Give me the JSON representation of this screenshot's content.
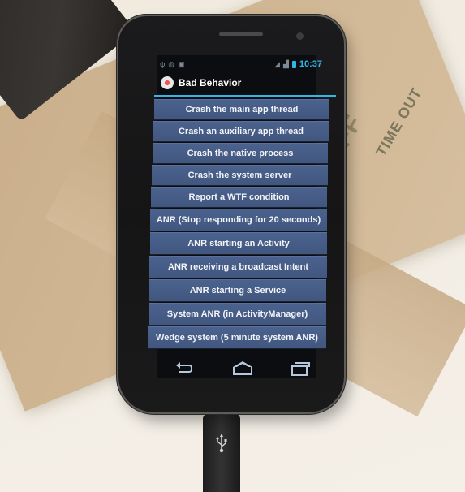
{
  "scene": {
    "napkin_print": {
      "line1": "OFF",
      "line2": "ON",
      "line3": "TIME OUT"
    }
  },
  "device": {
    "status_bar": {
      "left_icons": [
        "usb-debug-icon",
        "android-icon",
        "image-icon"
      ],
      "right_icons": [
        "signal-icon",
        "cellular-icon",
        "battery-icon"
      ],
      "time": "10:37"
    },
    "app": {
      "icon": "gear-icon",
      "title": "Bad Behavior",
      "accent_color": "#33b5e5",
      "buttons": [
        {
          "label": "Crash the main app thread"
        },
        {
          "label": "Crash an auxiliary app thread"
        },
        {
          "label": "Crash the native process"
        },
        {
          "label": "Crash the system server"
        },
        {
          "label": "Report a WTF condition"
        },
        {
          "label": "ANR (Stop responding for 20 seconds)"
        },
        {
          "label": "ANR starting an Activity"
        },
        {
          "label": "ANR receiving a broadcast Intent"
        },
        {
          "label": "ANR starting a Service"
        },
        {
          "label": "System ANR (in ActivityManager)"
        },
        {
          "label": "Wedge system (5 minute system ANR)"
        }
      ]
    },
    "nav_bar": {
      "back": "back-icon",
      "home": "home-icon",
      "recents": "recents-icon"
    },
    "usb_symbol": "⭍"
  }
}
